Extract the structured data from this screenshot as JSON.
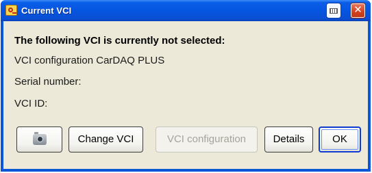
{
  "window": {
    "title": "Current VCI",
    "icon": "vci-app-icon",
    "controls": {
      "keyboard": "keyboard-icon",
      "close": "close-icon",
      "close_glyph": "✕"
    }
  },
  "message": {
    "heading": "The following VCI is currently not selected:",
    "lines": [
      "VCI configuration CarDAQ PLUS",
      "Serial number:",
      "VCI ID:"
    ]
  },
  "buttons": {
    "camera_icon": "camera-icon",
    "change_vci": "Change VCI",
    "vci_configuration": "VCI configuration",
    "details": "Details",
    "ok": "OK"
  },
  "colors": {
    "titlebar": "#0a55d8",
    "client_background": "#ece9d8",
    "close_button": "#d2421f",
    "default_button_border": "#0d3bd1"
  }
}
